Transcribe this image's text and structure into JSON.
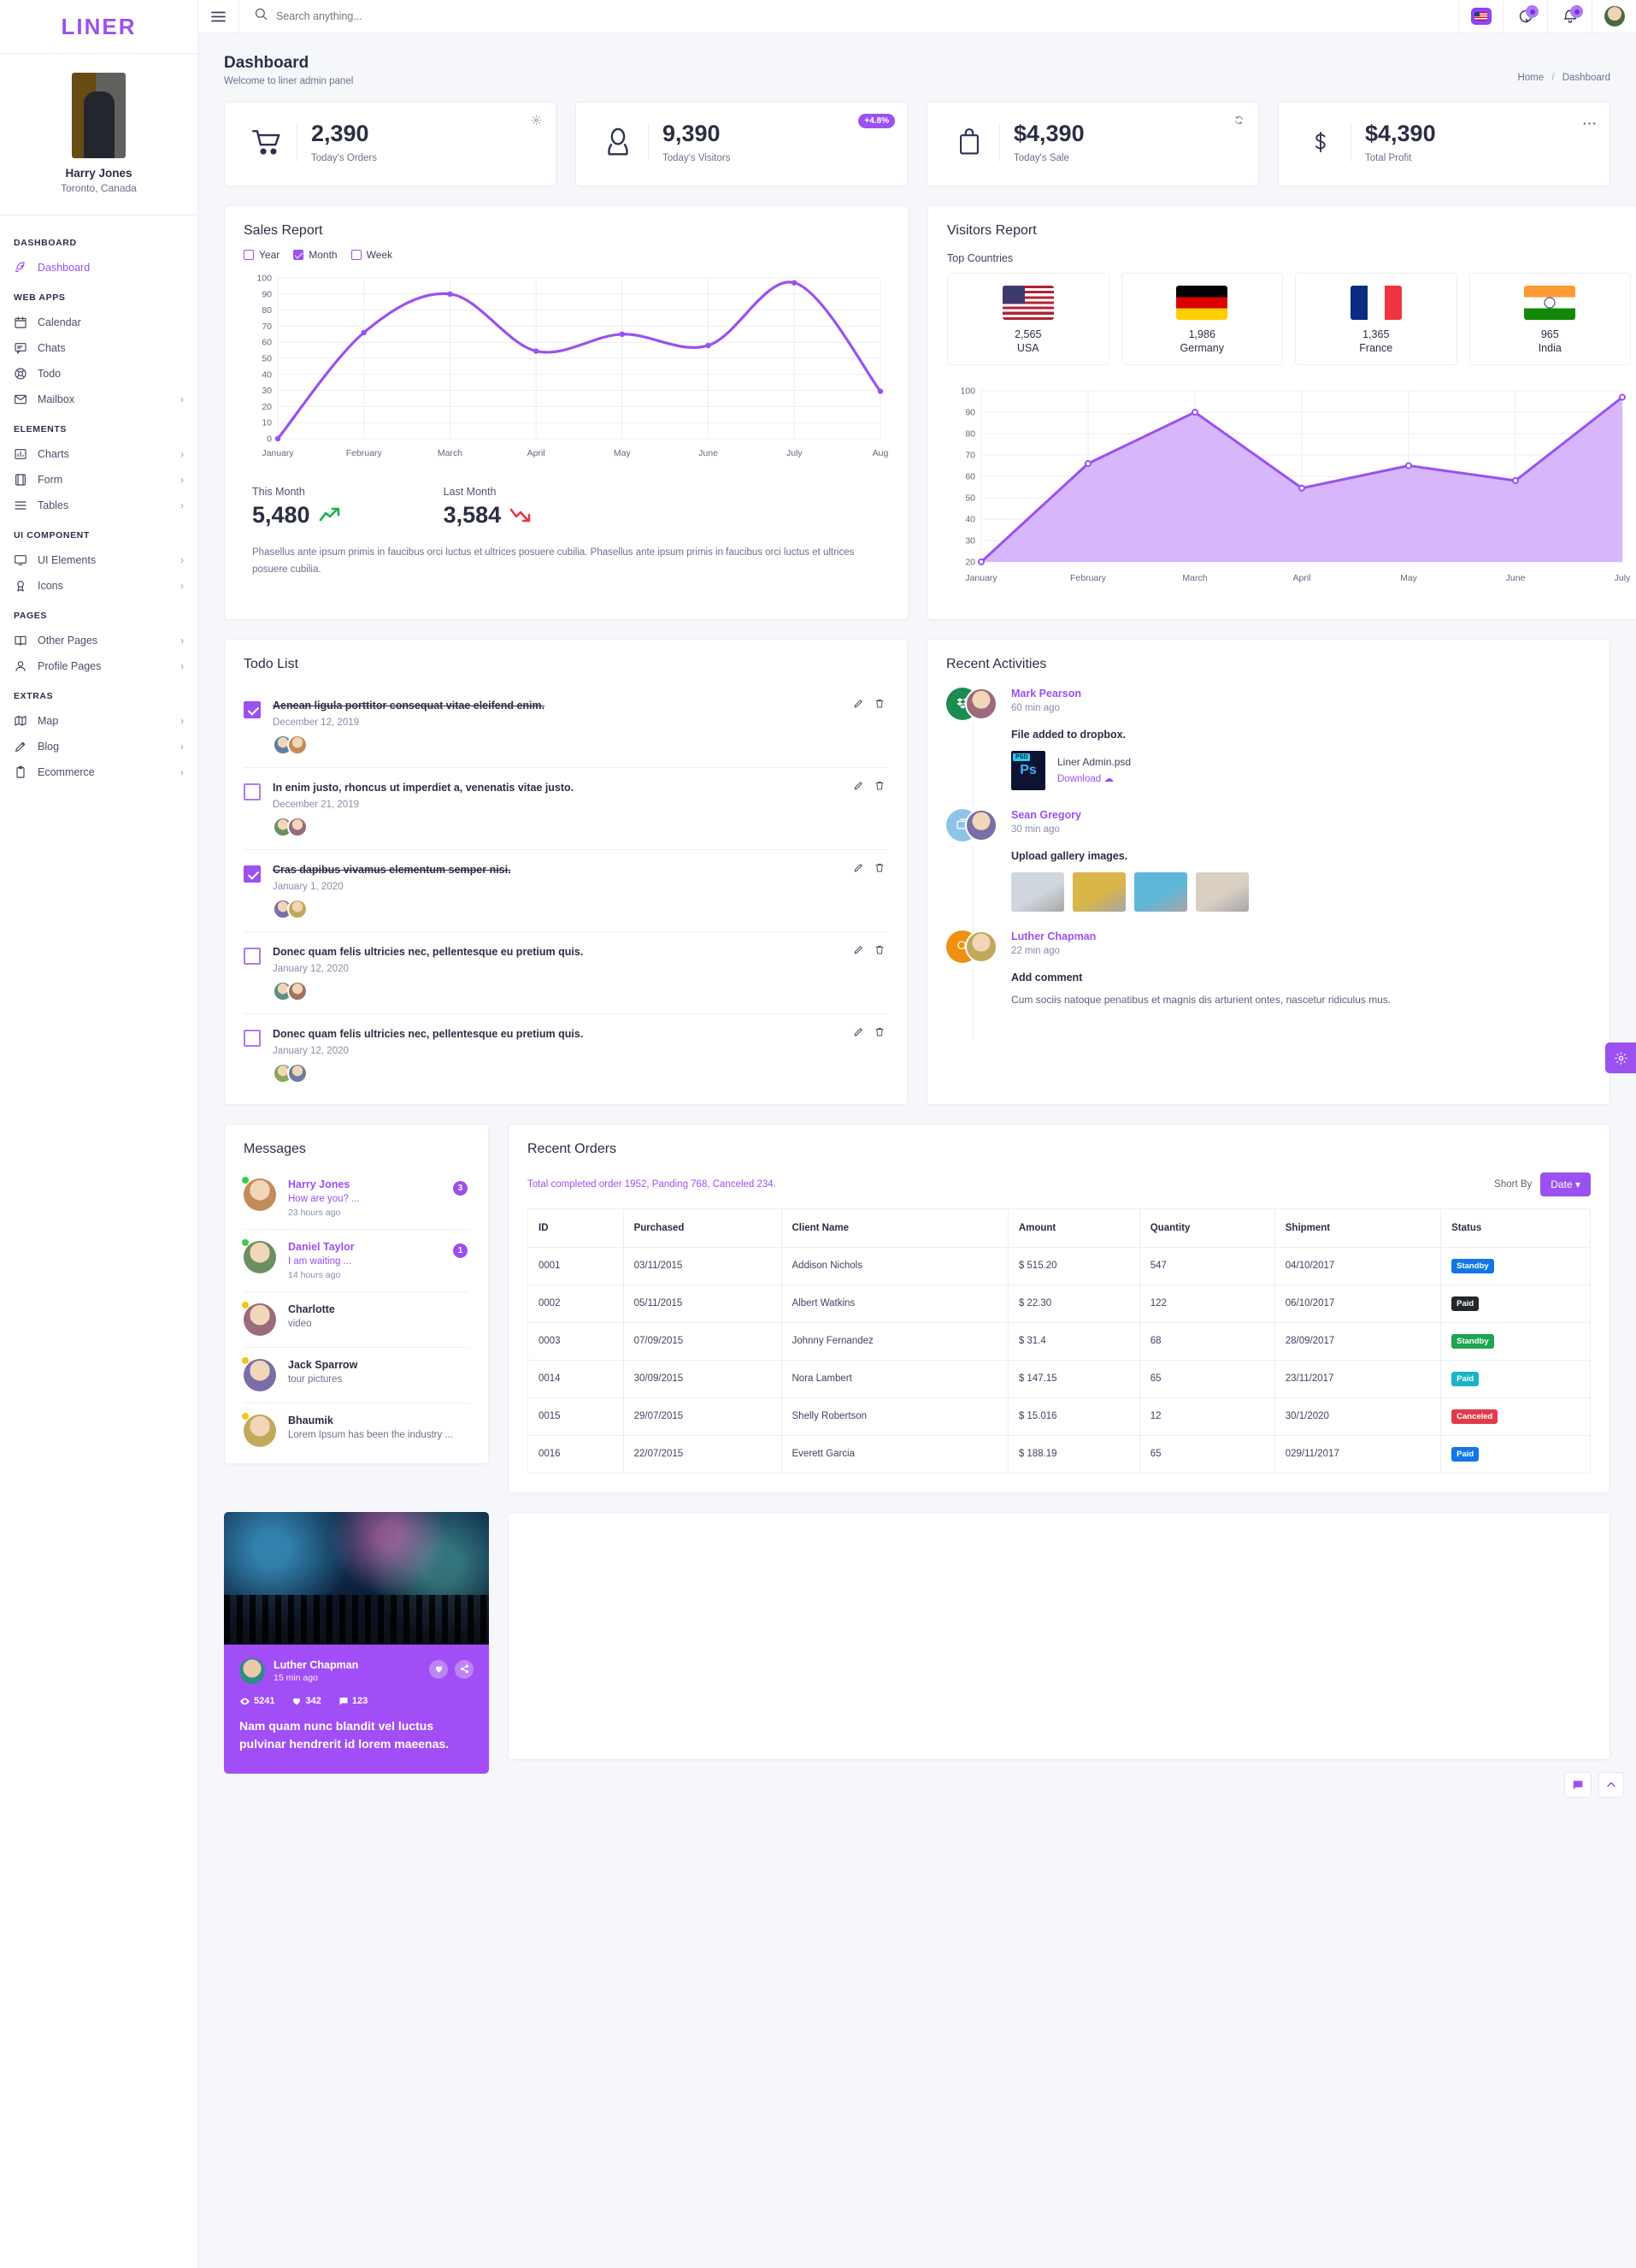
{
  "brand": {
    "name": "LINER"
  },
  "profile": {
    "name": "Harry Jones",
    "location": "Toronto, Canada"
  },
  "sidebar": {
    "sections": [
      {
        "heading": "DASHBOARD",
        "items": [
          {
            "label": "Dashboard",
            "icon": "rocket-icon",
            "active": true,
            "chevron": false
          }
        ]
      },
      {
        "heading": "WEB APPS",
        "items": [
          {
            "label": "Calendar",
            "icon": "calendar-icon",
            "chevron": false
          },
          {
            "label": "Chats",
            "icon": "chat-icon",
            "chevron": false
          },
          {
            "label": "Todo",
            "icon": "lifebuoy-icon",
            "chevron": false
          },
          {
            "label": "Mailbox",
            "icon": "envelope-icon",
            "chevron": true
          }
        ]
      },
      {
        "heading": "ELEMENTS",
        "items": [
          {
            "label": "Charts",
            "icon": "bar-chart-icon",
            "chevron": true
          },
          {
            "label": "Form",
            "icon": "form-icon",
            "chevron": true
          },
          {
            "label": "Tables",
            "icon": "table-icon",
            "chevron": true
          }
        ]
      },
      {
        "heading": "UI COMPONENT",
        "items": [
          {
            "label": "UI Elements",
            "icon": "monitor-icon",
            "chevron": true
          },
          {
            "label": "Icons",
            "icon": "award-icon",
            "chevron": true
          }
        ]
      },
      {
        "heading": "PAGES",
        "items": [
          {
            "label": "Other Pages",
            "icon": "book-icon",
            "chevron": true
          },
          {
            "label": "Profile Pages",
            "icon": "user-icon",
            "chevron": true
          }
        ]
      },
      {
        "heading": "EXTRAS",
        "items": [
          {
            "label": "Map",
            "icon": "map-icon",
            "chevron": true
          },
          {
            "label": "Blog",
            "icon": "pencil-icon",
            "chevron": true
          },
          {
            "label": "Ecommerce",
            "icon": "clipboard-icon",
            "chevron": true
          }
        ]
      }
    ]
  },
  "topbar": {
    "menu_icon": "hamburger-icon",
    "search": {
      "placeholder": "Search anything...",
      "value": "",
      "icon": "search-icon"
    },
    "language_flag": "us-flag-icon",
    "history_icon": "history-icon",
    "bell_icon": "bell-icon",
    "avatar": "user-avatar"
  },
  "page": {
    "title": "Dashboard",
    "subtitle": "Welcome to liner admin panel",
    "breadcrumb": {
      "home": "Home",
      "separator": "/",
      "current": "Dashboard"
    }
  },
  "stats": [
    {
      "value": "2,390",
      "label": "Today's Orders",
      "icon": "cart-icon",
      "corner": "gear-icon"
    },
    {
      "value": "9,390",
      "label": "Today's Visitors",
      "icon": "person-icon",
      "badge": "+4.8%"
    },
    {
      "value": "$4,390",
      "label": "Today's Sale",
      "icon": "bag-icon",
      "corner": "refresh-icon"
    },
    {
      "value": "$4,390",
      "label": "Total Profit",
      "icon": "dollar-icon",
      "corner": "more-icon"
    }
  ],
  "sales_report": {
    "title": "Sales Report",
    "filters": [
      {
        "label": "Year",
        "checked": false
      },
      {
        "label": "Month",
        "checked": true
      },
      {
        "label": "Week",
        "checked": false
      }
    ],
    "this_month": {
      "label": "This Month",
      "value": "5,480",
      "trend": "up",
      "trend_color": "#14b44a"
    },
    "last_month": {
      "label": "Last Month",
      "value": "3,584",
      "trend": "down",
      "trend_color": "#e63946"
    },
    "description": "Phasellus ante ipsum primis in faucibus orci luctus et ultrices posuere cubilia. Phasellus ante ipsum primis in faucibus orci luctus et ultrices posuere cubilia."
  },
  "visitors_report": {
    "title": "Visitors Report",
    "top_countries_label": "Top Countries",
    "countries": [
      {
        "count": "2,565",
        "name": "USA",
        "flag": "us-flag-icon"
      },
      {
        "count": "1,986",
        "name": "Germany",
        "flag": "de-flag-icon"
      },
      {
        "count": "1,365",
        "name": "France",
        "flag": "fr-flag-icon"
      },
      {
        "count": "965",
        "name": "India",
        "flag": "in-flag-icon"
      }
    ]
  },
  "chart_data": [
    {
      "type": "line",
      "title": "Sales Report",
      "categories": [
        "January",
        "February",
        "March",
        "April",
        "May",
        "June",
        "July",
        "Aug"
      ],
      "series": [
        {
          "name": "Sales",
          "values": [
            0,
            66,
            90,
            54.5,
            65,
            58,
            97,
            29.5
          ]
        }
      ],
      "xlabel": "",
      "ylabel": "",
      "ylim": [
        0,
        100
      ],
      "yticks": [
        0,
        10,
        20,
        30,
        40,
        50,
        60,
        70,
        80,
        90,
        100
      ],
      "grid": true,
      "legend": "top-left",
      "line_color": "#9b51f0",
      "smooth": true
    },
    {
      "type": "area",
      "title": "Visitors Report",
      "categories": [
        "January",
        "February",
        "March",
        "April",
        "May",
        "June",
        "July"
      ],
      "series": [
        {
          "name": "Visitors",
          "values": [
            20,
            66,
            90,
            54.5,
            65,
            58,
            97
          ]
        }
      ],
      "xlabel": "",
      "ylabel": "",
      "ylim": [
        20,
        100
      ],
      "yticks": [
        20,
        30,
        40,
        50,
        60,
        70,
        80,
        90,
        100
      ],
      "grid": true,
      "legend": "none",
      "line_color": "#9b51f0",
      "fill_color": "#d7b6fb"
    }
  ],
  "todo": {
    "title": "Todo List",
    "items": [
      {
        "text": "Aenean ligula porttitor consequat vitae eleifend enim.",
        "date": "December 12, 2019",
        "done": true
      },
      {
        "text": "In enim justo, rhoncus ut imperdiet a, venenatis vitae justo.",
        "date": "December 21, 2019",
        "done": false
      },
      {
        "text": "Cras dapibus vivamus elementum semper nisi.",
        "date": "January 1, 2020",
        "done": true
      },
      {
        "text": "Donec quam felis ultricies nec, pellentesque eu pretium quis.",
        "date": "January 12, 2020",
        "done": false
      },
      {
        "text": "Donec quam felis ultricies nec, pellentesque eu pretium quis.",
        "date": "January 12, 2020",
        "done": false
      }
    ]
  },
  "activities": {
    "title": "Recent Activities",
    "items": [
      {
        "name": "Mark Pearson",
        "time": "60 min ago",
        "kind": "file",
        "heading": "File added to dropbox.",
        "file_name": "Liner Admin.psd",
        "file_type": "PSD",
        "download_label": "Download"
      },
      {
        "name": "Sean Gregory",
        "time": "30 min ago",
        "kind": "gallery",
        "heading": "Upload gallery images."
      },
      {
        "name": "Luther Chapman",
        "time": "22 min ago",
        "kind": "comment",
        "heading": "Add comment",
        "text": "Cum sociis natoque penatibus et magnis dis arturient ontes, nascetur ridiculus mus."
      }
    ]
  },
  "messages": {
    "title": "Messages",
    "items": [
      {
        "name": "Harry Jones",
        "preview": "How are you? ...",
        "time": "23 hours ago",
        "badge": "3",
        "unread": true,
        "presence": "#3ec94e"
      },
      {
        "name": "Daniel Taylor",
        "preview": "I am waiting ...",
        "time": "14 hours ago",
        "badge": "1",
        "unread": true,
        "presence": "#3ec94e"
      },
      {
        "name": "Charlotte",
        "preview": "video",
        "time": "",
        "badge": "",
        "unread": false,
        "presence": "#f5c518"
      },
      {
        "name": "Jack Sparrow",
        "preview": "tour pictures",
        "time": "",
        "badge": "",
        "unread": false,
        "presence": "#f5c518"
      },
      {
        "name": "Bhaumik",
        "preview": "Lorem Ipsum has been the industry ...",
        "time": "",
        "badge": "",
        "unread": false,
        "presence": "#f5c518"
      }
    ]
  },
  "orders": {
    "title": "Recent Orders",
    "note": "Total completed order 1952, Panding 768, Canceled 234.",
    "sort_label": "Short By",
    "sort_value": "Date",
    "columns": [
      "ID",
      "Purchased",
      "Client Name",
      "Amount",
      "Quantity",
      "Shipment",
      "Status"
    ],
    "rows": [
      {
        "id": "0001",
        "purchased": "03/11/2015",
        "client": "Addison Nichols",
        "amount": "$ 515.20",
        "quantity": "547",
        "shipment": "04/10/2017",
        "status": "Standby",
        "status_color": "#1177e8"
      },
      {
        "id": "0002",
        "purchased": "05/11/2015",
        "client": "Albert Watkins",
        "amount": "$ 22.30",
        "quantity": "122",
        "shipment": "06/10/2017",
        "status": "Paid",
        "status_color": "#23272b"
      },
      {
        "id": "0003",
        "purchased": "07/09/2015",
        "client": "Johnny Fernandez",
        "amount": "$ 31.4",
        "quantity": "68",
        "shipment": "28/09/2017",
        "status": "Standby",
        "status_color": "#1ea550"
      },
      {
        "id": "0014",
        "purchased": "30/09/2015",
        "client": "Nora Lambert",
        "amount": "$ 147.15",
        "quantity": "65",
        "shipment": "23/11/2017",
        "status": "Paid",
        "status_color": "#1ab3c8"
      },
      {
        "id": "0015",
        "purchased": "29/07/2015",
        "client": "Shelly Robertson",
        "amount": "$ 15.016",
        "quantity": "12",
        "shipment": "30/1/2020",
        "status": "Canceled",
        "status_color": "#e03a4c"
      },
      {
        "id": "0016",
        "purchased": "22/07/2015",
        "client": "Everett Garcia",
        "amount": "$ 188.19",
        "quantity": "65",
        "shipment": "029/11/2017",
        "status": "Paid",
        "status_color": "#1177e8"
      }
    ]
  },
  "post": {
    "author": "Luther Chapman",
    "time": "15 min ago",
    "views": "5241",
    "likes": "342",
    "comments": "123",
    "text": "Nam quam nunc blandit vel luctus pulvinar hendrerit id lorem maeenas.",
    "like_icon": "heart-icon",
    "share_icon": "share-icon"
  },
  "floating": {
    "gear": "gear-icon",
    "chat": "chat-icon",
    "scroll_top": "chevron-up-icon"
  },
  "colors": {
    "accent": "#9b51f0",
    "bg": "#f6f7fb",
    "text": "#2b2e45"
  }
}
